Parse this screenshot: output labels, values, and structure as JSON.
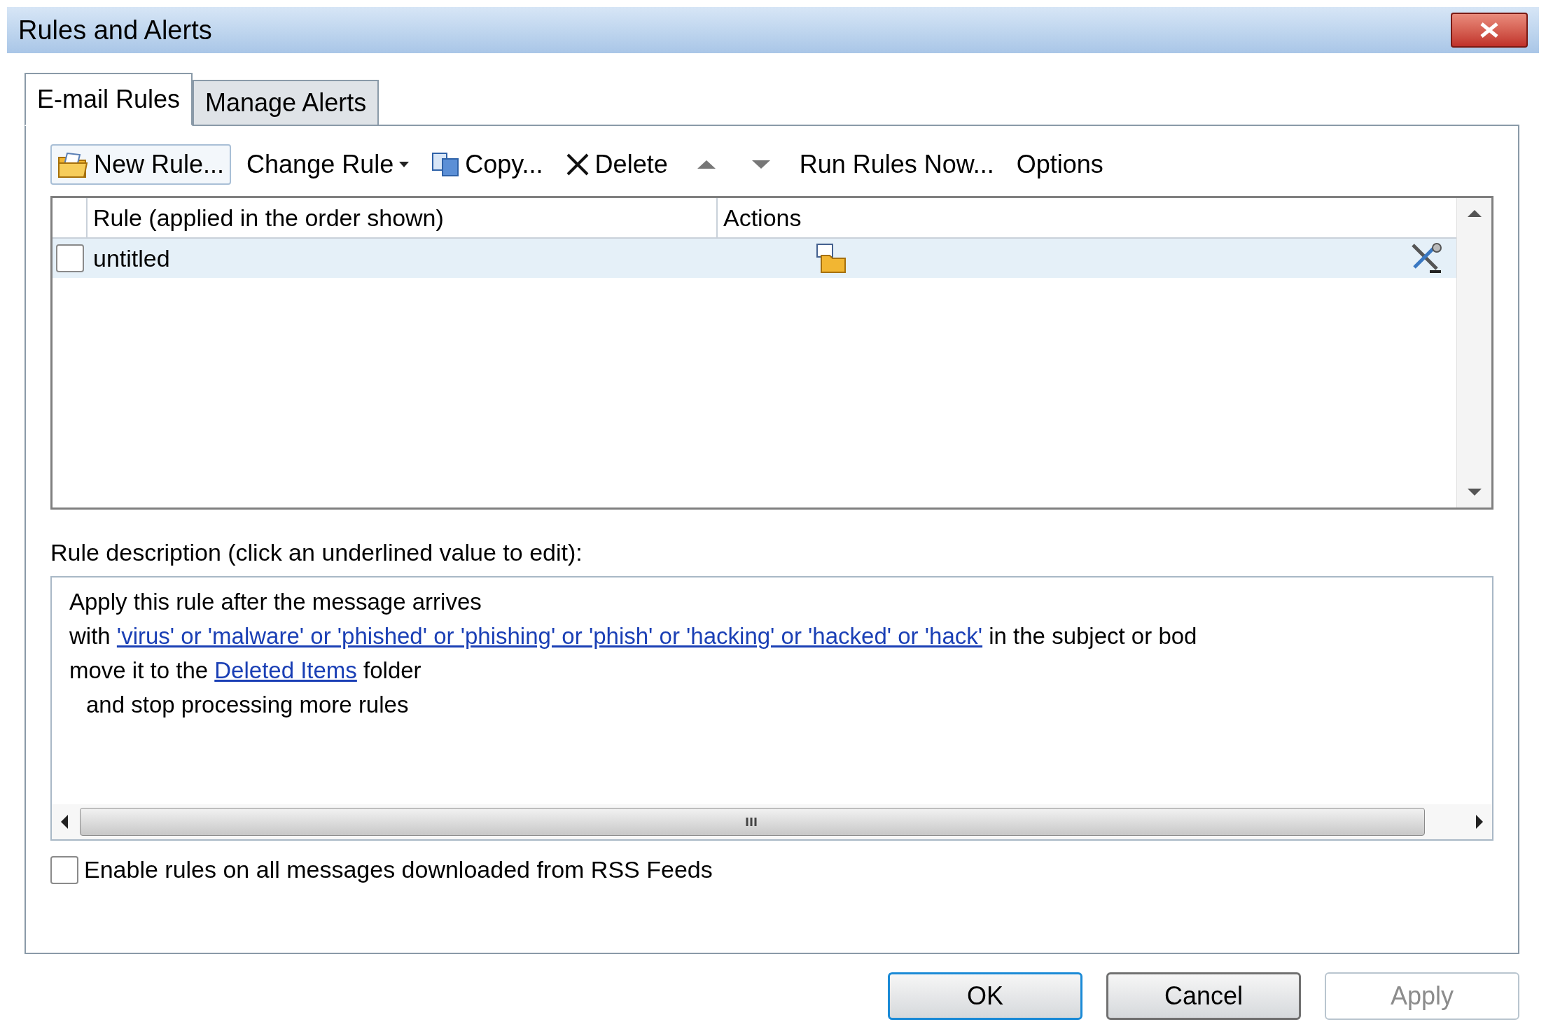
{
  "window": {
    "title": "Rules and Alerts"
  },
  "tabs": [
    {
      "label": "E-mail Rules",
      "selected": true
    },
    {
      "label": "Manage Alerts",
      "selected": false
    }
  ],
  "toolbar": [
    {
      "kind": "new",
      "label": "New Rule...",
      "highlighted": true
    },
    {
      "kind": "dropdown",
      "label": "Change Rule",
      "highlighted": false
    },
    {
      "kind": "copy",
      "label": "Copy...",
      "highlighted": false
    },
    {
      "kind": "delete",
      "label": "Delete",
      "highlighted": false
    },
    {
      "kind": "up",
      "highlighted": false
    },
    {
      "kind": "down",
      "highlighted": false
    },
    {
      "kind": "plain",
      "label": "Run Rules Now...",
      "highlighted": false
    },
    {
      "kind": "plain",
      "label": "Options",
      "highlighted": false
    }
  ],
  "rules_table": {
    "columns": [
      "Rule (applied in the order shown)",
      "Actions"
    ],
    "rows": [
      {
        "name": "untitled",
        "checked": false,
        "selected": true
      }
    ]
  },
  "description": {
    "label": "Rule description (click an underlined value to edit):",
    "lines": [
      {
        "indented": false,
        "parts": [
          {
            "kind": "text",
            "text": "Apply this rule after the message arrives"
          }
        ]
      },
      {
        "indented": false,
        "parts": [
          {
            "kind": "text",
            "text": "with "
          },
          {
            "kind": "link",
            "text": "'virus' or 'malware' or 'phished' or 'phishing' or 'phish' or 'hacking' or 'hacked' or 'hack'"
          },
          {
            "kind": "text",
            "text": " in the subject or bod"
          }
        ]
      },
      {
        "indented": false,
        "parts": [
          {
            "kind": "text",
            "text": "move it to the "
          },
          {
            "kind": "link",
            "text": "Deleted Items"
          },
          {
            "kind": "text",
            "text": " folder"
          }
        ]
      },
      {
        "indented": true,
        "parts": [
          {
            "kind": "text",
            "text": "and stop processing more rules"
          }
        ]
      }
    ]
  },
  "rss_option": {
    "label": "Enable rules on all messages downloaded from RSS Feeds",
    "checked": false
  },
  "buttons": [
    {
      "label": "OK",
      "default": true,
      "disabled": false
    },
    {
      "label": "Cancel",
      "default": false,
      "disabled": false
    },
    {
      "label": "Apply",
      "default": false,
      "disabled": true
    }
  ]
}
